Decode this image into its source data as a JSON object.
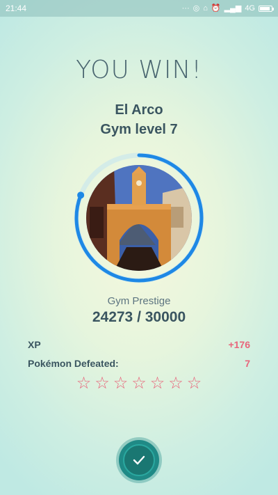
{
  "status_bar": {
    "time": "21:44",
    "icons": [
      "dots-icon",
      "hotspot-icon",
      "bag-icon",
      "alarm-icon",
      "signal-icon"
    ],
    "network": "4G"
  },
  "result": {
    "title": "YOU WIN!",
    "gym_name": "El Arco",
    "gym_level": "Gym level 7"
  },
  "prestige": {
    "label": "Gym Prestige",
    "value_text": "24273 / 30000",
    "current": 24273,
    "max": 30000,
    "ring_color": "#1e88e5"
  },
  "stats": {
    "xp_label": "XP",
    "xp_value": "+176",
    "defeated_label": "Pokémon Defeated:",
    "defeated_value": "7",
    "stars_count": 7
  },
  "colors": {
    "accent": "#e8647a",
    "text": "#3a5560",
    "confirm": "#1f8a86"
  },
  "confirm_icon": "check-icon"
}
